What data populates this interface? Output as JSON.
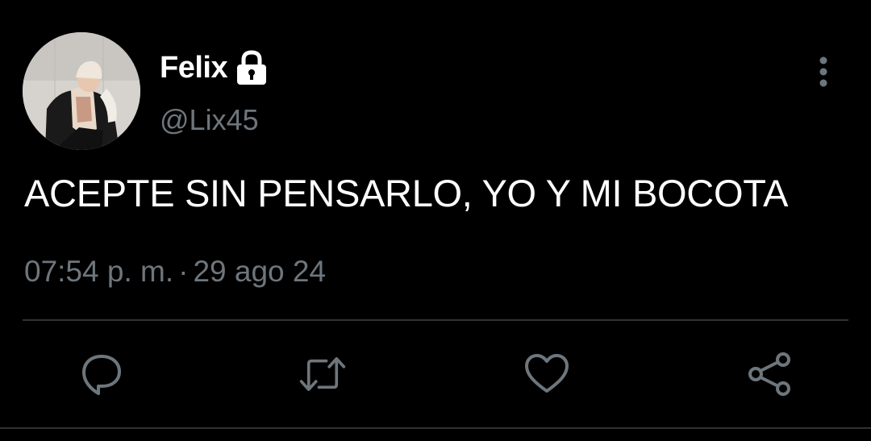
{
  "tweet": {
    "display_name": "Felix",
    "handle": "@Lix45",
    "text": "ACEPTE SIN PENSARLO, YO Y MI BOCOTA",
    "time": "07:54 p. m.",
    "separator": "·",
    "date": "29 ago 24",
    "protected_icon": "lock-icon",
    "more_icon": "vertical-ellipsis-icon"
  },
  "actions": {
    "reply_icon": "reply-icon",
    "retweet_icon": "retweet-icon",
    "like_icon": "heart-icon",
    "share_icon": "share-icon"
  },
  "colors": {
    "background": "#000000",
    "primary_text": "#ffffff",
    "secondary_text": "#6e767d",
    "divider": "#2f3336"
  }
}
